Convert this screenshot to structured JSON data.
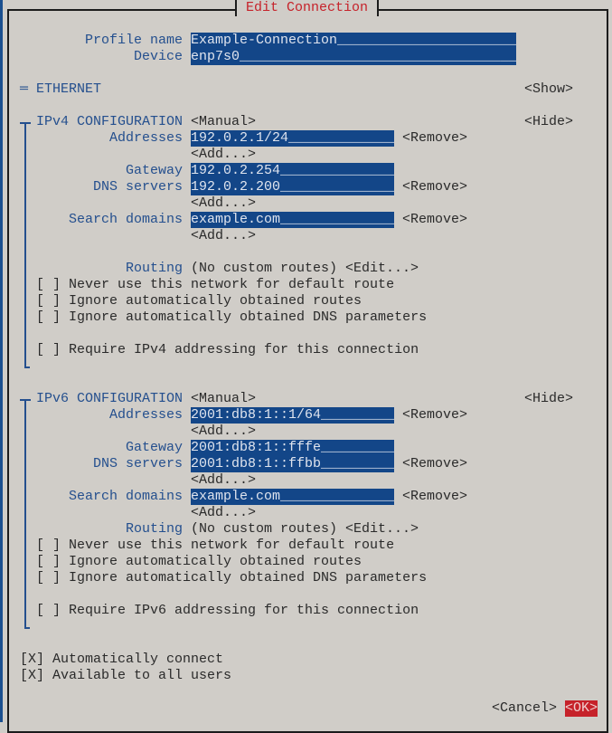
{
  "dialog": {
    "title": "Edit Connection"
  },
  "profile": {
    "profile_name_label": "Profile name",
    "profile_name_value": "Example-Connection",
    "device_label": "Device",
    "device_value": "enp7s0"
  },
  "ethernet": {
    "label": "ETHERNET",
    "toggle": "<Show>"
  },
  "ipv4": {
    "label": "IPv4 CONFIGURATION",
    "mode": "<Manual>",
    "toggle": "<Hide>",
    "addresses_label": "Addresses",
    "address_value": "192.0.2.1/24",
    "gateway_label": "Gateway",
    "gateway_value": "192.0.2.254",
    "dns_label": "DNS servers",
    "dns_value": "192.0.2.200",
    "search_label": "Search domains",
    "search_value": "example.com",
    "remove": "<Remove>",
    "add": "<Add...>",
    "routing_label": "Routing",
    "routing_value": "(No custom routes)",
    "routing_edit": "<Edit...>",
    "never_default": "[ ] Never use this network for default route",
    "ignore_routes": "[ ] Ignore automatically obtained routes",
    "ignore_dns": "[ ] Ignore automatically obtained DNS parameters",
    "require": "[ ] Require IPv4 addressing for this connection"
  },
  "ipv6": {
    "label": "IPv6 CONFIGURATION",
    "mode": "<Manual>",
    "toggle": "<Hide>",
    "addresses_label": "Addresses",
    "address_value": "2001:db8:1::1/64",
    "gateway_label": "Gateway",
    "gateway_value": "2001:db8:1::fffe",
    "dns_label": "DNS servers",
    "dns_value": "2001:db8:1::ffbb",
    "search_label": "Search domains",
    "search_value": "example.com",
    "remove": "<Remove>",
    "add": "<Add...>",
    "routing_label": "Routing",
    "routing_value": "(No custom routes)",
    "routing_edit": "<Edit...>",
    "never_default": "[ ] Never use this network for default route",
    "ignore_routes": "[ ] Ignore automatically obtained routes",
    "ignore_dns": "[ ] Ignore automatically obtained DNS parameters",
    "require": "[ ] Require IPv6 addressing for this connection"
  },
  "options": {
    "auto_connect": "[X] Automatically connect",
    "all_users": "[X] Available to all users"
  },
  "buttons": {
    "cancel": "<Cancel>",
    "ok": "<OK>"
  },
  "colors": {
    "background": "#d0cdc8",
    "label": "#244f8e",
    "field": "#134688",
    "title": "#c6222a",
    "ok": "#c6222a"
  }
}
